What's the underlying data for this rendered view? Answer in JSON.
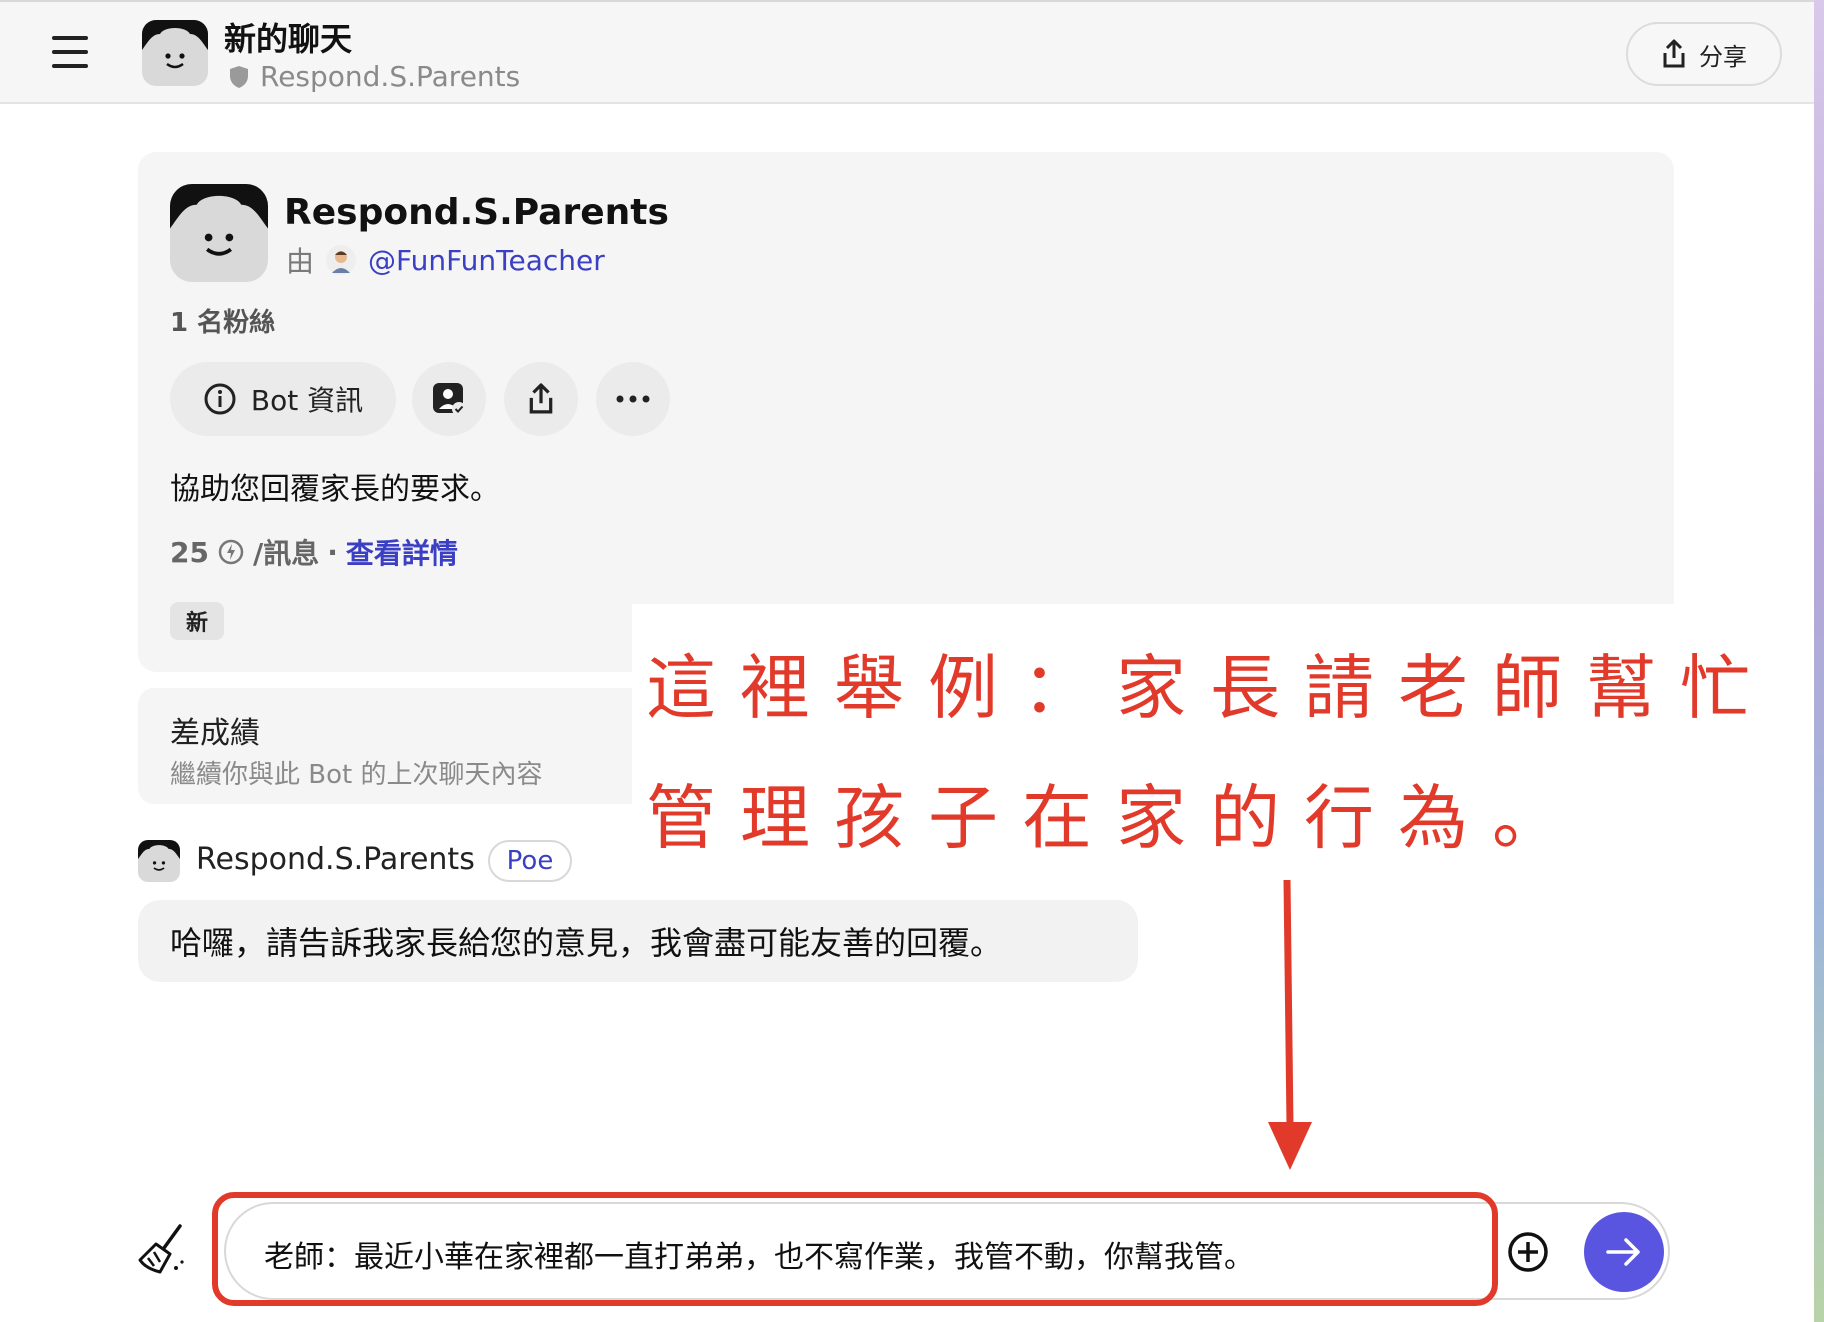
{
  "header": {
    "title": "新的聊天",
    "bot_subtitle": "Respond.S.Parents",
    "share_label": "分享"
  },
  "bot_card": {
    "name": "Respond.S.Parents",
    "by_label": "由",
    "creator_handle": "@FunFunTeacher",
    "followers": "1 名粉絲",
    "info_button": "Bot 資訊",
    "description": "協助您回覆家長的要求。",
    "price_value": "25",
    "price_unit": "/訊息",
    "price_separator": "·",
    "details_link": "查看詳情",
    "new_tag": "新"
  },
  "previous_chat": {
    "title": "差成績",
    "subtitle": "繼續你與此 Bot 的上次聊天內容"
  },
  "annotation": {
    "line1": "這裡舉例：家長請老師幫忙",
    "line2": "管理孩子在家的行為。",
    "color": "#e23a2a"
  },
  "message": {
    "sender": "Respond.S.Parents",
    "badge": "Poe",
    "text": "哈囉，請告訴我家長給您的意見，我會盡可能友善的回覆。"
  },
  "composer": {
    "value": "老師：最近小華在家裡都一直打弟弟，也不寫作業，我管不動，你幫我管。"
  },
  "colors": {
    "accent": "#5a55e0",
    "link": "#3b3fc4",
    "annotation_red": "#e23a2a"
  }
}
